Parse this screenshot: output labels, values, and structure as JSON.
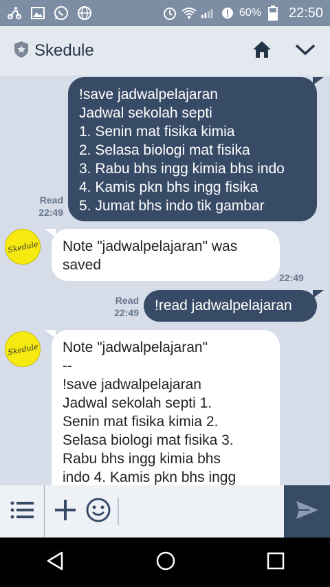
{
  "status_bar": {
    "battery": "60%",
    "time": "22:50"
  },
  "header": {
    "title": "Skedule"
  },
  "messages": [
    {
      "lines": [
        "!save jadwalpelajaran",
        "Jadwal sekolah septi",
        "1. Senin mat fisika kimia",
        "2. Selasa biologi mat fisika",
        "3. Rabu bhs ingg kimia bhs indo",
        "4. Kamis pkn bhs ingg fisika",
        "5. Jumat bhs indo tik gambar"
      ],
      "read": "Read",
      "time": "22:49"
    },
    {
      "lines": [
        "Note \"jadwalpelajaran\" was",
        "saved"
      ],
      "time": "22:49"
    },
    {
      "lines": [
        "!read jadwalpelajaran"
      ],
      "read": "Read",
      "time": "22:49"
    },
    {
      "lines": [
        "Note \"jadwalpelajaran\"",
        "--",
        "!save jadwalpelajaran",
        "Jadwal sekolah septi 1.",
        "Senin mat fisika kimia 2.",
        "Selasa biologi mat fisika 3.",
        "Rabu bhs ingg kimia bhs",
        "indo 4. Kamis pkn bhs ingg"
      ]
    }
  ],
  "avatar_label": "Skedule",
  "input": {
    "placeholder": ""
  },
  "colors": {
    "status_bar": "#7d8da4",
    "header_bg": "#e4e9f0",
    "chat_bg": "#d6dde8",
    "outgoing_bubble": "#384b66",
    "incoming_bubble": "#ffffff",
    "avatar": "#f5e90f"
  }
}
